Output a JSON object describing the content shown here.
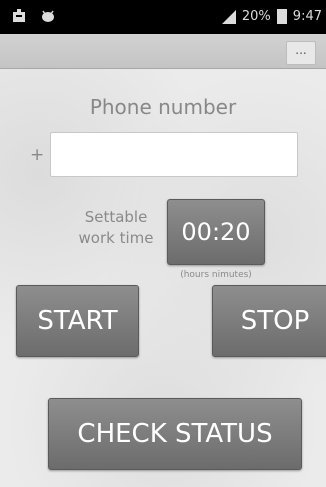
{
  "status_bar": {
    "left_icons": [
      "notification-icon",
      "android-debug-icon"
    ],
    "signal_icon": "signal-icon",
    "battery_percent": "20%",
    "battery_icon": "battery-charging-icon",
    "time": "9:47"
  },
  "action_bar": {
    "overflow_label": "..."
  },
  "form": {
    "phone_label": "Phone number",
    "country_prefix": "+",
    "phone_value": "",
    "settable_line1": "Settable",
    "settable_line2": "work time",
    "time_value": "00:20",
    "time_hint": "(hours nimutes)"
  },
  "buttons": {
    "start": "START",
    "stop": "STOP",
    "check_status": "CHECK STATUS"
  },
  "colors": {
    "button_top": "#8e8e8e",
    "button_bottom": "#6c6c6c",
    "background": "#ebebeb",
    "status_bar": "#000000"
  }
}
